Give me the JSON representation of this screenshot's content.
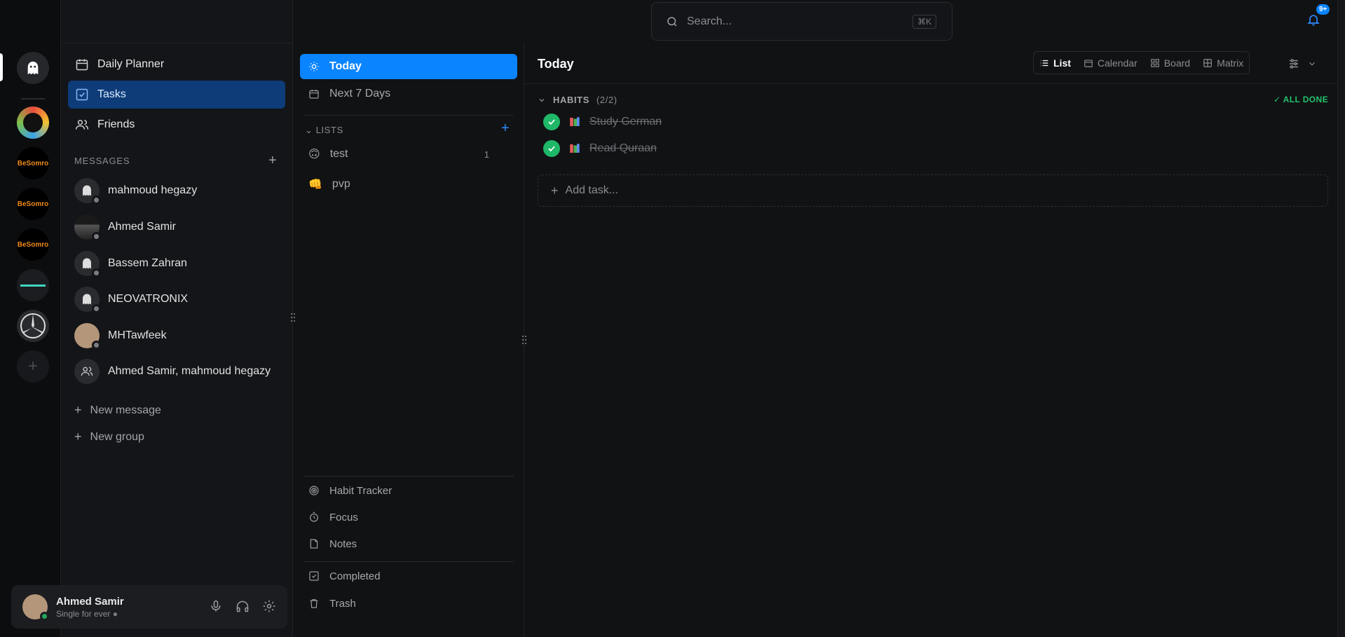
{
  "search": {
    "placeholder": "Search...",
    "shortcut": "⌘K"
  },
  "notifications": {
    "badge": "9+"
  },
  "rail": {
    "servers": [
      {
        "name": "ghost-server",
        "logo_text": ""
      },
      {
        "name": "badge-server",
        "logo_text": ""
      },
      {
        "name": "besomro-1",
        "logo_text": "BeSomro"
      },
      {
        "name": "besomro-2",
        "logo_text": "BeSomro"
      },
      {
        "name": "besomro-3",
        "logo_text": "BeSomro"
      },
      {
        "name": "neon-server",
        "logo_text": ""
      },
      {
        "name": "mercedes-server",
        "logo_text": ""
      }
    ]
  },
  "sidebar": {
    "nav": [
      {
        "label": "Daily Planner",
        "icon": "calendar-icon"
      },
      {
        "label": "Tasks",
        "icon": "checkbox-icon",
        "active": true
      },
      {
        "label": "Friends",
        "icon": "users-icon"
      }
    ],
    "messages_title": "MESSAGES",
    "dms": [
      {
        "name": "mahmoud hegazy"
      },
      {
        "name": "Ahmed Samir"
      },
      {
        "name": "Bassem Zahran"
      },
      {
        "name": "NEOVATRONIX"
      },
      {
        "name": "MHTawfeek"
      },
      {
        "name": "Ahmed Samir, mahmoud hegazy"
      }
    ],
    "new_message": "New message",
    "new_group": "New group"
  },
  "user": {
    "name": "Ahmed Samir",
    "status": "Single for ever"
  },
  "lists_panel": {
    "today": "Today",
    "next7": "Next 7 Days",
    "lists_title": "LISTS",
    "lists": [
      {
        "emoji": "🙃",
        "name": "test",
        "count": "1"
      },
      {
        "emoji": "👊",
        "name": "pvp",
        "count": ""
      }
    ],
    "bottom": [
      {
        "label": "Habit Tracker",
        "icon": "target-icon"
      },
      {
        "label": "Focus",
        "icon": "timer-icon"
      },
      {
        "label": "Notes",
        "icon": "note-icon"
      },
      {
        "label": "Completed",
        "icon": "checkbox-icon"
      },
      {
        "label": "Trash",
        "icon": "trash-icon"
      }
    ]
  },
  "main": {
    "title": "Today",
    "views": [
      {
        "label": "List",
        "active": true
      },
      {
        "label": "Calendar"
      },
      {
        "label": "Board"
      },
      {
        "label": "Matrix"
      }
    ],
    "habits_label": "HABITS",
    "habits_count": "(2/2)",
    "all_done": "✓ ALL DONE",
    "tasks": [
      {
        "title": "Study German",
        "done": true
      },
      {
        "title": "Read Quraan",
        "done": true
      }
    ],
    "add_task": "Add task..."
  },
  "colors": {
    "accent": "#0a84ff",
    "active_nav": "#0d3c78",
    "done": "#1fb868"
  }
}
